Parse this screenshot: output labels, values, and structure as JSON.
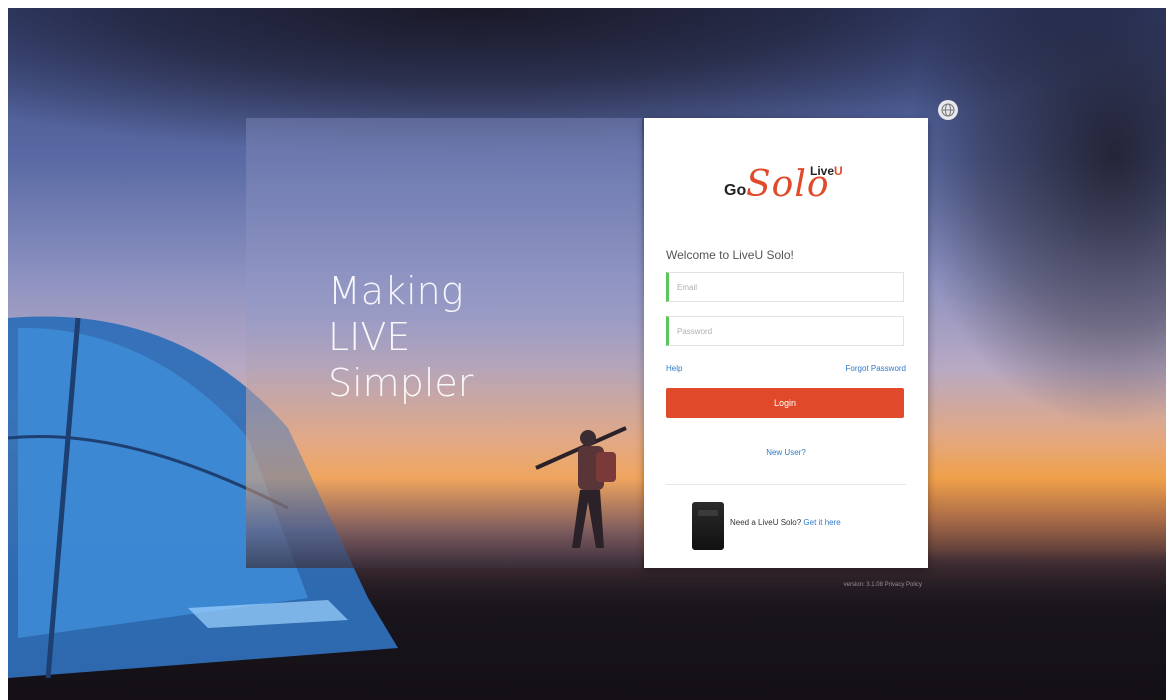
{
  "hero": {
    "tagline": [
      "Making",
      "LIVE",
      "Simpler"
    ]
  },
  "header": {
    "globe_icon": "globe-icon"
  },
  "login": {
    "logo": {
      "go": "Go",
      "solo": "Solo",
      "liveu_prefix": "Live",
      "liveu_suffix": "U"
    },
    "welcome": "Welcome to LiveU Solo!",
    "email_placeholder": "Email",
    "password_placeholder": "Password",
    "help_label": "Help",
    "forgot_label": "Forgot Password",
    "login_label": "Login",
    "new_user_label": "New User?",
    "promo_text": "Need a LiveU Solo?",
    "promo_link": "Get it here"
  },
  "footer": {
    "version": "version: 3.1.08",
    "privacy": "Privacy Policy"
  },
  "colors": {
    "accent": "#e04a2a",
    "link": "#2f7ac7",
    "field_focus": "#5cc65c"
  }
}
